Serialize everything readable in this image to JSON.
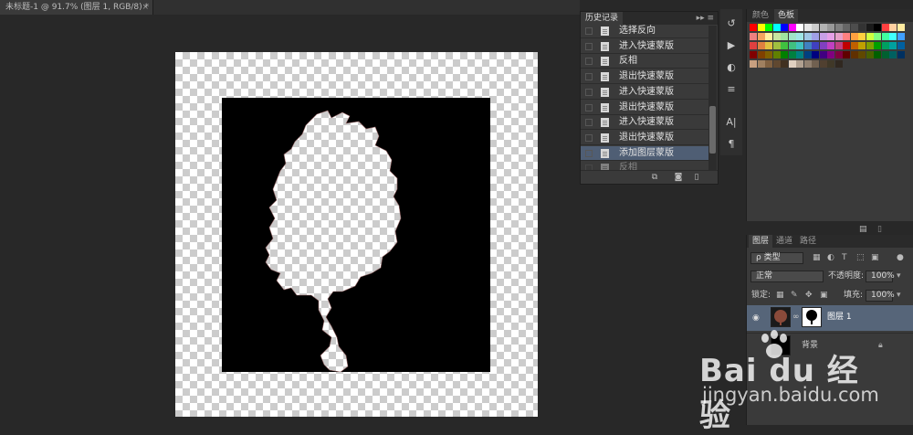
{
  "document_tab": {
    "title": "未标题-1 @ 91.7% (图层 1, RGB/8) *",
    "close": "×"
  },
  "history": {
    "tab_label": "历史记录",
    "menu_glyph": "▸▸ ≡",
    "items": [
      {
        "label": "选择反向",
        "selected": false
      },
      {
        "label": "进入快速蒙版",
        "selected": false
      },
      {
        "label": "反相",
        "selected": false
      },
      {
        "label": "退出快速蒙版",
        "selected": false
      },
      {
        "label": "进入快速蒙版",
        "selected": false
      },
      {
        "label": "退出快速蒙版",
        "selected": false
      },
      {
        "label": "进入快速蒙版",
        "selected": false
      },
      {
        "label": "退出快速蒙版",
        "selected": false
      },
      {
        "label": "添加图层蒙版",
        "selected": true
      },
      {
        "label": "反相",
        "selected": false
      }
    ],
    "footer_icons": [
      "new-document-from-state-icon",
      "snapshot-camera-icon",
      "trash-icon"
    ]
  },
  "side_strip": {
    "icons": [
      "history-icon",
      "actions-icon",
      "adjustments-icon",
      "properties-icon",
      "character-icon",
      "paragraph-icon"
    ],
    "char_glyph": "A|",
    "para_glyph": "¶"
  },
  "swatches_panel": {
    "tabs": [
      "颜色",
      "色板"
    ],
    "active_tab": "色板",
    "colors": [
      "#ff0000",
      "#ffff00",
      "#00ff00",
      "#00ffff",
      "#0000ff",
      "#ff00ff",
      "#ffffff",
      "#e6e6e6",
      "#cccccc",
      "#b3b3b3",
      "#999999",
      "#808080",
      "#666666",
      "#4d4d4d",
      "#333333",
      "#1a1a1a",
      "#000000",
      "#ff4040",
      "#ffd0a0",
      "#ffeba0",
      "#f08080",
      "#f4a460",
      "#fff0a0",
      "#c8e6a0",
      "#a0e6a0",
      "#a0e6c8",
      "#a0e6e6",
      "#a0c8e6",
      "#a0a0e6",
      "#c8a0e6",
      "#e6a0e6",
      "#e6a0c8",
      "#ff8080",
      "#ffa040",
      "#ffd040",
      "#d0ff40",
      "#80ff80",
      "#40ffa0",
      "#40ffff",
      "#40a0ff",
      "#e04040",
      "#e08040",
      "#e0c040",
      "#a0c040",
      "#40c040",
      "#40c080",
      "#40c0c0",
      "#4080c0",
      "#4040c0",
      "#8040c0",
      "#c040c0",
      "#c04080",
      "#c00000",
      "#c06000",
      "#c0a000",
      "#80a000",
      "#00a000",
      "#00a060",
      "#00a0a0",
      "#0060a0",
      "#800000",
      "#804000",
      "#806000",
      "#608000",
      "#008000",
      "#008040",
      "#008080",
      "#004080",
      "#000080",
      "#400080",
      "#800080",
      "#800040",
      "#600000",
      "#603000",
      "#604800",
      "#486000",
      "#006000",
      "#006030",
      "#006060",
      "#003060",
      "#c8a080",
      "#a08060",
      "#806040",
      "#604830",
      "#403020",
      "#e0d0c0",
      "#b0a090",
      "#908070",
      "#706050",
      "#504030",
      "#403828",
      "#302820"
    ]
  },
  "layers_panel": {
    "tabs": [
      "图层",
      "通道",
      "路径"
    ],
    "active_tab": "图层",
    "filter_label": "ρ 类型",
    "blend_mode": "正常",
    "opacity_label": "不透明度:",
    "opacity_value": "100%",
    "lock_label": "锁定:",
    "fill_label": "填充:",
    "fill_value": "100%",
    "layers": [
      {
        "name": "图层 1",
        "visible": true,
        "selected": true
      },
      {
        "name": "背景",
        "visible": false,
        "selected": false
      }
    ]
  },
  "watermark": {
    "brand": "Bai du 经验",
    "url": "jingyan.baidu.com"
  }
}
